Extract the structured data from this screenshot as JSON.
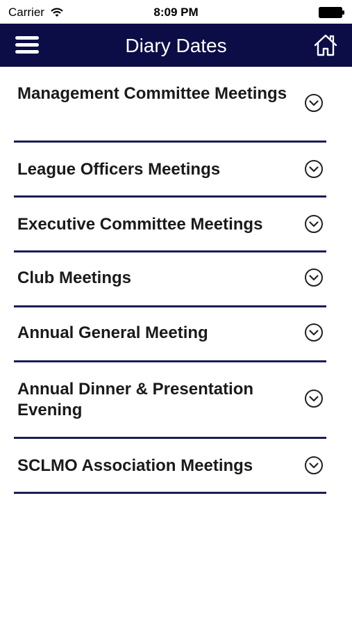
{
  "status_bar": {
    "carrier": "Carrier",
    "time": "8:09 PM"
  },
  "nav": {
    "title": "Diary Dates",
    "menu_icon": "hamburger-menu-icon",
    "home_icon": "home-icon",
    "background_color": "#0c0d47"
  },
  "list": {
    "items": [
      {
        "label": "Management Committee Meetings"
      },
      {
        "label": "League Officers Meetings"
      },
      {
        "label": "Executive Committee Meetings"
      },
      {
        "label": "Club Meetings"
      },
      {
        "label": "Annual General Meeting"
      },
      {
        "label": "Annual Dinner & Presentation Evening"
      },
      {
        "label": "SCLMO Association Meetings"
      }
    ],
    "chevron_icon": "chevron-down-circle-icon",
    "divider_color": "#1c1c55"
  }
}
